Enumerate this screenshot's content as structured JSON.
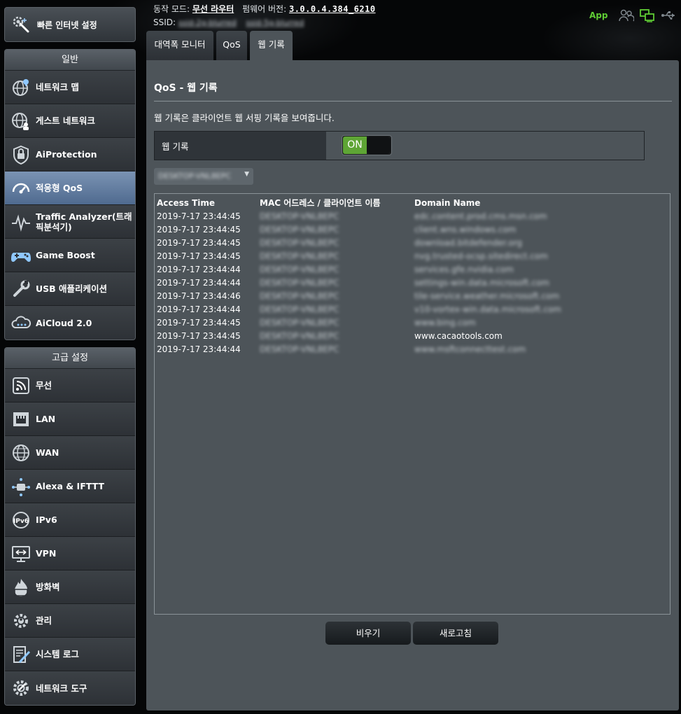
{
  "quick_setup": {
    "label": "빠른 인터넷 설정",
    "icon": "wand-gear-icon"
  },
  "general": {
    "title": "일반",
    "items": [
      {
        "label": "네트워크 맵",
        "icon": "globe-pin-icon",
        "active": false
      },
      {
        "label": "게스트 네트워크",
        "icon": "globe-users-icon",
        "active": false
      },
      {
        "label": "AiProtection",
        "icon": "lock-icon",
        "active": false
      },
      {
        "label": "적응형 QoS",
        "icon": "speedometer-icon",
        "active": true
      },
      {
        "label": "Traffic Analyzer(트래픽분석기)",
        "icon": "pulse-icon",
        "active": false
      },
      {
        "label": "Game Boost",
        "icon": "gamepad-icon",
        "active": false
      },
      {
        "label": "USB 애플리케이션",
        "icon": "usb-wrench-icon",
        "active": false
      },
      {
        "label": "AiCloud 2.0",
        "icon": "cloud-icon",
        "active": false
      }
    ]
  },
  "advanced": {
    "title": "고급 설정",
    "items": [
      {
        "label": "무선",
        "icon": "wifi-icon"
      },
      {
        "label": "LAN",
        "icon": "lan-port-icon"
      },
      {
        "label": "WAN",
        "icon": "globe-icon"
      },
      {
        "label": "Alexa & IFTTT",
        "icon": "alexa-icon"
      },
      {
        "label": "IPv6",
        "icon": "ipv6-globe-icon"
      },
      {
        "label": "VPN",
        "icon": "vpn-monitor-icon"
      },
      {
        "label": "방화벽",
        "icon": "flame-icon"
      },
      {
        "label": "관리",
        "icon": "admin-gear-icon"
      },
      {
        "label": "시스템 로그",
        "icon": "log-pencil-icon"
      },
      {
        "label": "네트워크 도구",
        "icon": "tools-gear-icon"
      }
    ]
  },
  "header": {
    "mode_label": "동작 모드:",
    "mode_value": "무선 라우터",
    "firmware_label": "펌웨어 버전:",
    "firmware_value": "3.0.0.4.384_6210",
    "ssid_label": "SSID:",
    "ssid_values": [
      "ssid-2g-blurred",
      "ssid-5g-blurred"
    ],
    "app_label": "App",
    "status_icons": [
      "clients-icon",
      "network-status-icon",
      "usb-status-icon"
    ]
  },
  "tabs": [
    {
      "label": "대역폭 모니터",
      "active": false
    },
    {
      "label": "QoS",
      "active": false
    },
    {
      "label": "웹 기록",
      "active": true
    }
  ],
  "main": {
    "title": "QoS - 웹 기록",
    "description": "웹 기록은 클라이언트 웹 서핑 기록을 보여줍니다.",
    "toggle_label": "웹 기록",
    "toggle_state": "ON",
    "client_filter_value": "DESKTOP-VNL8EPC",
    "columns": [
      "Access Time",
      "MAC 어드레스 / 클라이언트 이름",
      "Domain Name"
    ],
    "rows": [
      {
        "time": "2019-7-17  23:44:45",
        "client": "DESKTOP-VNL8EPC",
        "domain": "edc.content.prod.cms.msn.com",
        "blurred_domain": true
      },
      {
        "time": "2019-7-17  23:44:45",
        "client": "DESKTOP-VNL8EPC",
        "domain": "client.wns.windows.com",
        "blurred_domain": true
      },
      {
        "time": "2019-7-17  23:44:45",
        "client": "DESKTOP-VNL8EPC",
        "domain": "download.bitdefender.org",
        "blurred_domain": true
      },
      {
        "time": "2019-7-17  23:44:45",
        "client": "DESKTOP-VNL8EPC",
        "domain": "nvg.trusted-ocsp.sitedirect.com",
        "blurred_domain": true
      },
      {
        "time": "2019-7-17  23:44:44",
        "client": "DESKTOP-VNL8EPC",
        "domain": "services.gfe.nvidia.com",
        "blurred_domain": true
      },
      {
        "time": "2019-7-17  23:44:44",
        "client": "DESKTOP-VNL8EPC",
        "domain": "settings-win.data.microsoft.com",
        "blurred_domain": true
      },
      {
        "time": "2019-7-17  23:44:46",
        "client": "DESKTOP-VNL8EPC",
        "domain": "tile-service.weather.microsoft.com",
        "blurred_domain": true
      },
      {
        "time": "2019-7-17  23:44:44",
        "client": "DESKTOP-VNL8EPC",
        "domain": "v10-vortex-win.data.microsoft.com",
        "blurred_domain": true
      },
      {
        "time": "2019-7-17  23:44:45",
        "client": "DESKTOP-VNL8EPC",
        "domain": "www.bing.com",
        "blurred_domain": true
      },
      {
        "time": "2019-7-17  23:44:45",
        "client": "DESKTOP-VNL8EPC",
        "domain": "www.cacaotools.com",
        "blurred_domain": false
      },
      {
        "time": "2019-7-17  23:44:44",
        "client": "DESKTOP-VNL8EPC",
        "domain": "www.msftconnecttest.com",
        "blurred_domain": true
      }
    ],
    "buttons": {
      "clear": "비우기",
      "refresh": "새로고침"
    }
  },
  "colors": {
    "active_menu": "#6a84a6",
    "toggle_on": "#5ea535",
    "app_label": "#5fcc34",
    "panel_bg": "#4d5459"
  }
}
